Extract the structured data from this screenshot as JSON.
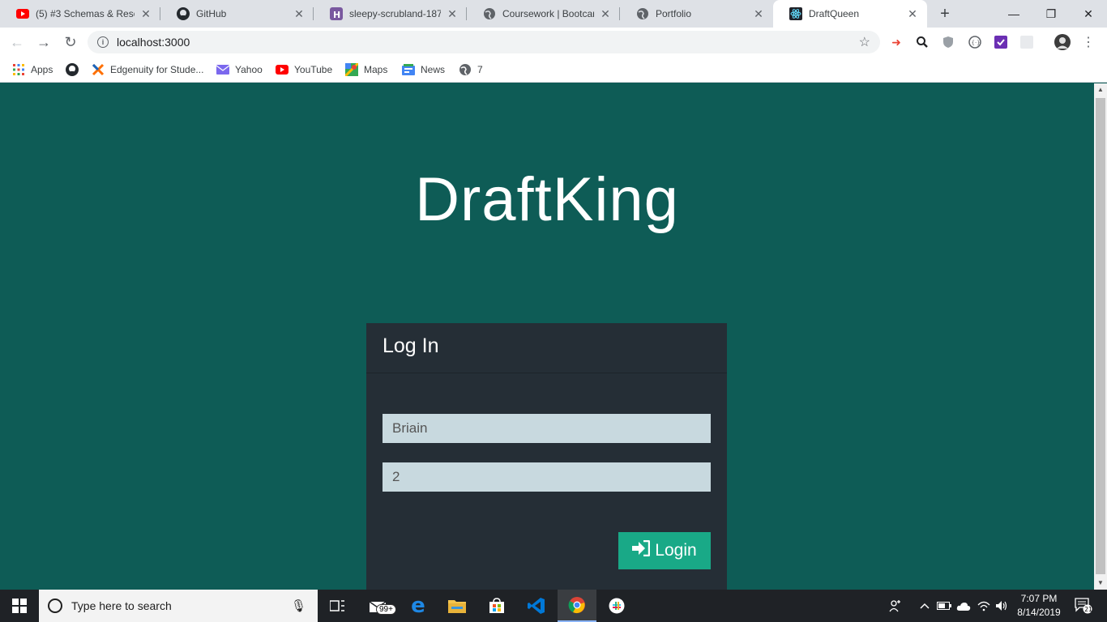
{
  "browser": {
    "tabs": [
      {
        "title": "(5) #3 Schemas & Resol",
        "icon": "youtube-icon",
        "active": false
      },
      {
        "title": "GitHub",
        "icon": "github-icon",
        "active": false
      },
      {
        "title": "sleepy-scrubland-1876",
        "icon": "heroku-icon",
        "active": false
      },
      {
        "title": "Coursework | Bootcamp",
        "icon": "globe-icon",
        "active": false
      },
      {
        "title": "Portfolio",
        "icon": "globe-icon",
        "active": false
      },
      {
        "title": "DraftQueen",
        "icon": "react-icon",
        "active": true
      }
    ],
    "new_tab": "+",
    "window_controls": {
      "minimize": "—",
      "maximize": "❐",
      "close": "✕"
    },
    "nav": {
      "back": "←",
      "forward": "→",
      "reload": "↻"
    },
    "address": "localhost:3000",
    "bookmarks": [
      {
        "label": "Apps",
        "icon": "apps-grid-icon"
      },
      {
        "label": "",
        "icon": "github-icon"
      },
      {
        "label": "Edgenuity for Stude...",
        "icon": "edgenuity-icon"
      },
      {
        "label": "Yahoo",
        "icon": "mail-icon"
      },
      {
        "label": "YouTube",
        "icon": "youtube-icon"
      },
      {
        "label": "Maps",
        "icon": "maps-icon"
      },
      {
        "label": "News",
        "icon": "news-icon"
      },
      {
        "label": "7",
        "icon": "globe-icon"
      }
    ]
  },
  "page": {
    "app_title": "DraftKing",
    "login_card": {
      "heading": "Log In",
      "username_value": "Briain",
      "password_value": "2",
      "button_label": "Login",
      "button_icon": "sign-in-icon"
    }
  },
  "taskbar": {
    "search_placeholder": "Type here to search",
    "badge": "99+",
    "time": "7:07 PM",
    "date": "8/14/2019",
    "notifications": "21"
  },
  "colors": {
    "page_bg": "#0e5c56",
    "card_bg": "#252e36",
    "input_bg": "#c8d9df",
    "button_bg": "#19a987"
  }
}
